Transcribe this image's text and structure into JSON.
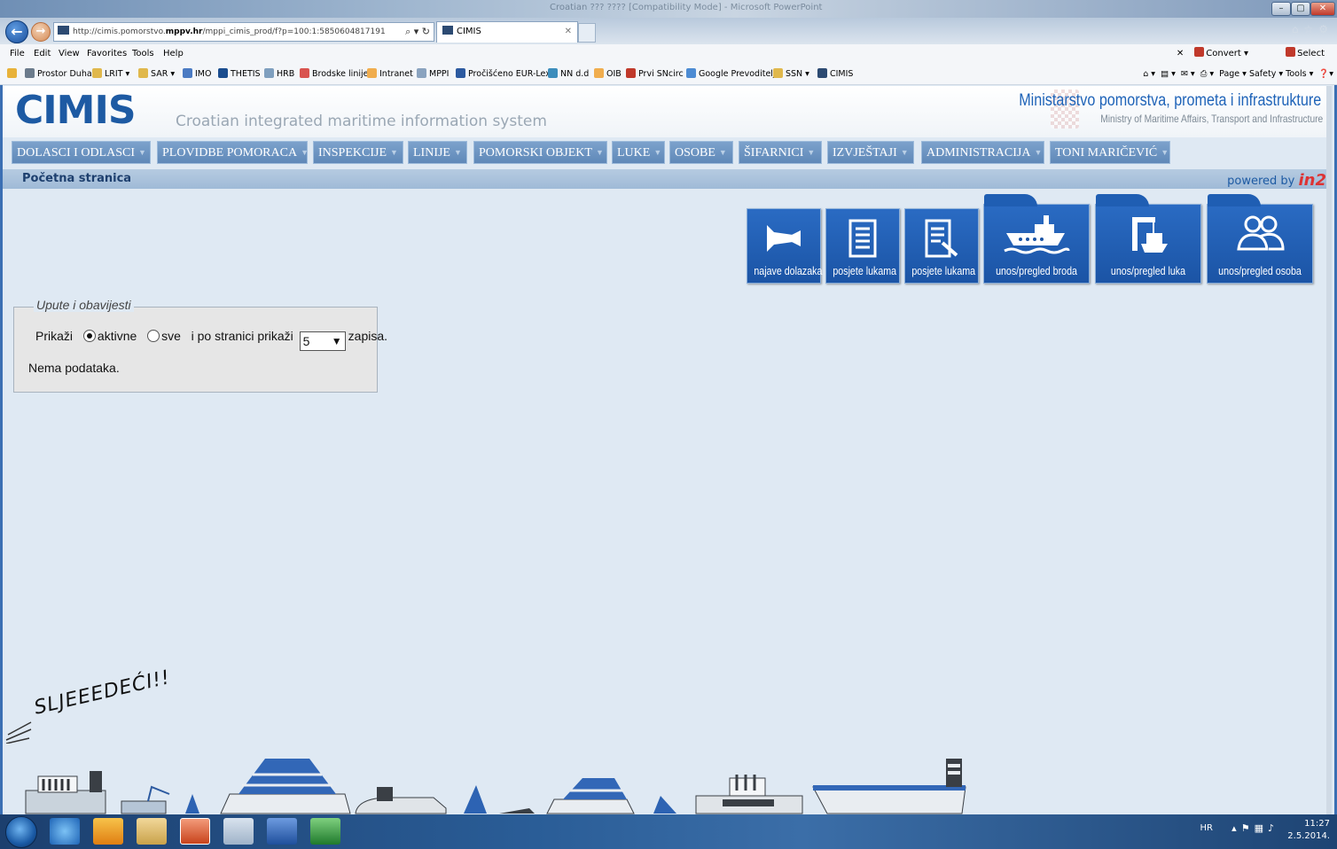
{
  "browser": {
    "window_title": "Croatian ??? ???? [Compatibility Mode] - Microsoft PowerPoint",
    "address_prefix": "http://cimis.pomorstvo.",
    "address_domain": "mppv.hr",
    "address_path": "/mppi_cimis_prod/f?p=100:1:5850604817191",
    "tab_title": "CIMIS",
    "menu": [
      "File",
      "Edit",
      "View",
      "Favorites",
      "Tools",
      "Help"
    ],
    "convert_label": "Convert",
    "select_label": "Select",
    "favorites": [
      {
        "label": "Prostor Duha",
        "icon": "gear-icon",
        "color": "#6b7b8c"
      },
      {
        "label": "LRIT ▾",
        "icon": "folder-icon",
        "color": "#e0b84c"
      },
      {
        "label": "SAR ▾",
        "icon": "folder-icon",
        "color": "#e0b84c"
      },
      {
        "label": "IMO",
        "icon": "page-icon",
        "color": "#4b7bc3"
      },
      {
        "label": "THETIS",
        "icon": "page-icon",
        "color": "#1a4d8f"
      },
      {
        "label": "HRB",
        "icon": "globe-icon",
        "color": "#7f9fbf"
      },
      {
        "label": "Brodske linije",
        "icon": "page-icon",
        "color": "#d9534f"
      },
      {
        "label": "Intranet",
        "icon": "page-icon",
        "color": "#f0ad4e"
      },
      {
        "label": "MPPI",
        "icon": "page-icon",
        "color": "#8aa3bf"
      },
      {
        "label": "Pročišćeno EUR-Lex",
        "icon": "page-icon",
        "color": "#2c5aa0"
      },
      {
        "label": "NN d.d",
        "icon": "page-icon",
        "color": "#3c8dbc"
      },
      {
        "label": "OIB",
        "icon": "page-icon",
        "color": "#f0ad4e"
      },
      {
        "label": "Prvi SNcirc",
        "icon": "page-icon",
        "color": "#c0392b"
      },
      {
        "label": "Google Prevoditelj",
        "icon": "page-icon",
        "color": "#4c8bd3"
      },
      {
        "label": "SSN ▾",
        "icon": "folder-icon",
        "color": "#e0b84c"
      },
      {
        "label": "CIMIS",
        "icon": "page-icon",
        "color": "#2c4a72"
      }
    ],
    "command_bar": "Page ▾   Safety ▾   Tools ▾"
  },
  "header": {
    "logo": "CIMIS",
    "subtitle": "Croatian integrated maritime information system",
    "ministry_title": "Ministarstvo pomorstva, prometa i infrastrukture",
    "ministry_subtitle": "Ministry of Maritime Affairs, Transport and Infrastructure"
  },
  "nav": [
    {
      "label": "DOLASCI I ODLASCI"
    },
    {
      "label": "PLOVIDBE POMORACA"
    },
    {
      "label": "INSPEKCIJE"
    },
    {
      "label": "LINIJE"
    },
    {
      "label": "POMORSKI OBJEKT"
    },
    {
      "label": "LUKE"
    },
    {
      "label": "OSOBE"
    },
    {
      "label": "ŠIFARNICI"
    },
    {
      "label": "IZVJEŠTAJI"
    },
    {
      "label": "ADMINISTRACIJA"
    },
    {
      "label": "TONI MARIČEVIĆ"
    }
  ],
  "breadcrumb": "Početna stranica",
  "powered_by": "powered by",
  "powered_logo": "in2",
  "tiles": [
    {
      "label": "najave dolazaka",
      "icon": "megaphone-icon"
    },
    {
      "label": "posjete lukama",
      "icon": "document-icon"
    },
    {
      "label": "posjete lukama",
      "icon": "document-edit-icon"
    },
    {
      "label": "unos/pregled broda",
      "icon": "ship-icon"
    },
    {
      "label": "unos/pregled luka",
      "icon": "port-crane-icon"
    },
    {
      "label": "unos/pregled osoba",
      "icon": "users-icon"
    }
  ],
  "notices": {
    "legend": "Upute i obavijesti",
    "show_label": "Prikaži",
    "option_active": "aktivne",
    "option_all": "sve",
    "per_page_label": "i po stranici prikaži",
    "per_page_value": "5",
    "records_label": "zapisa.",
    "empty_text": "Nema podataka."
  },
  "footer_art_text": "SLJEEEDEĆI!!",
  "taskbar": {
    "lang": "HR",
    "time": "11:27",
    "date": "2.5.2014."
  }
}
